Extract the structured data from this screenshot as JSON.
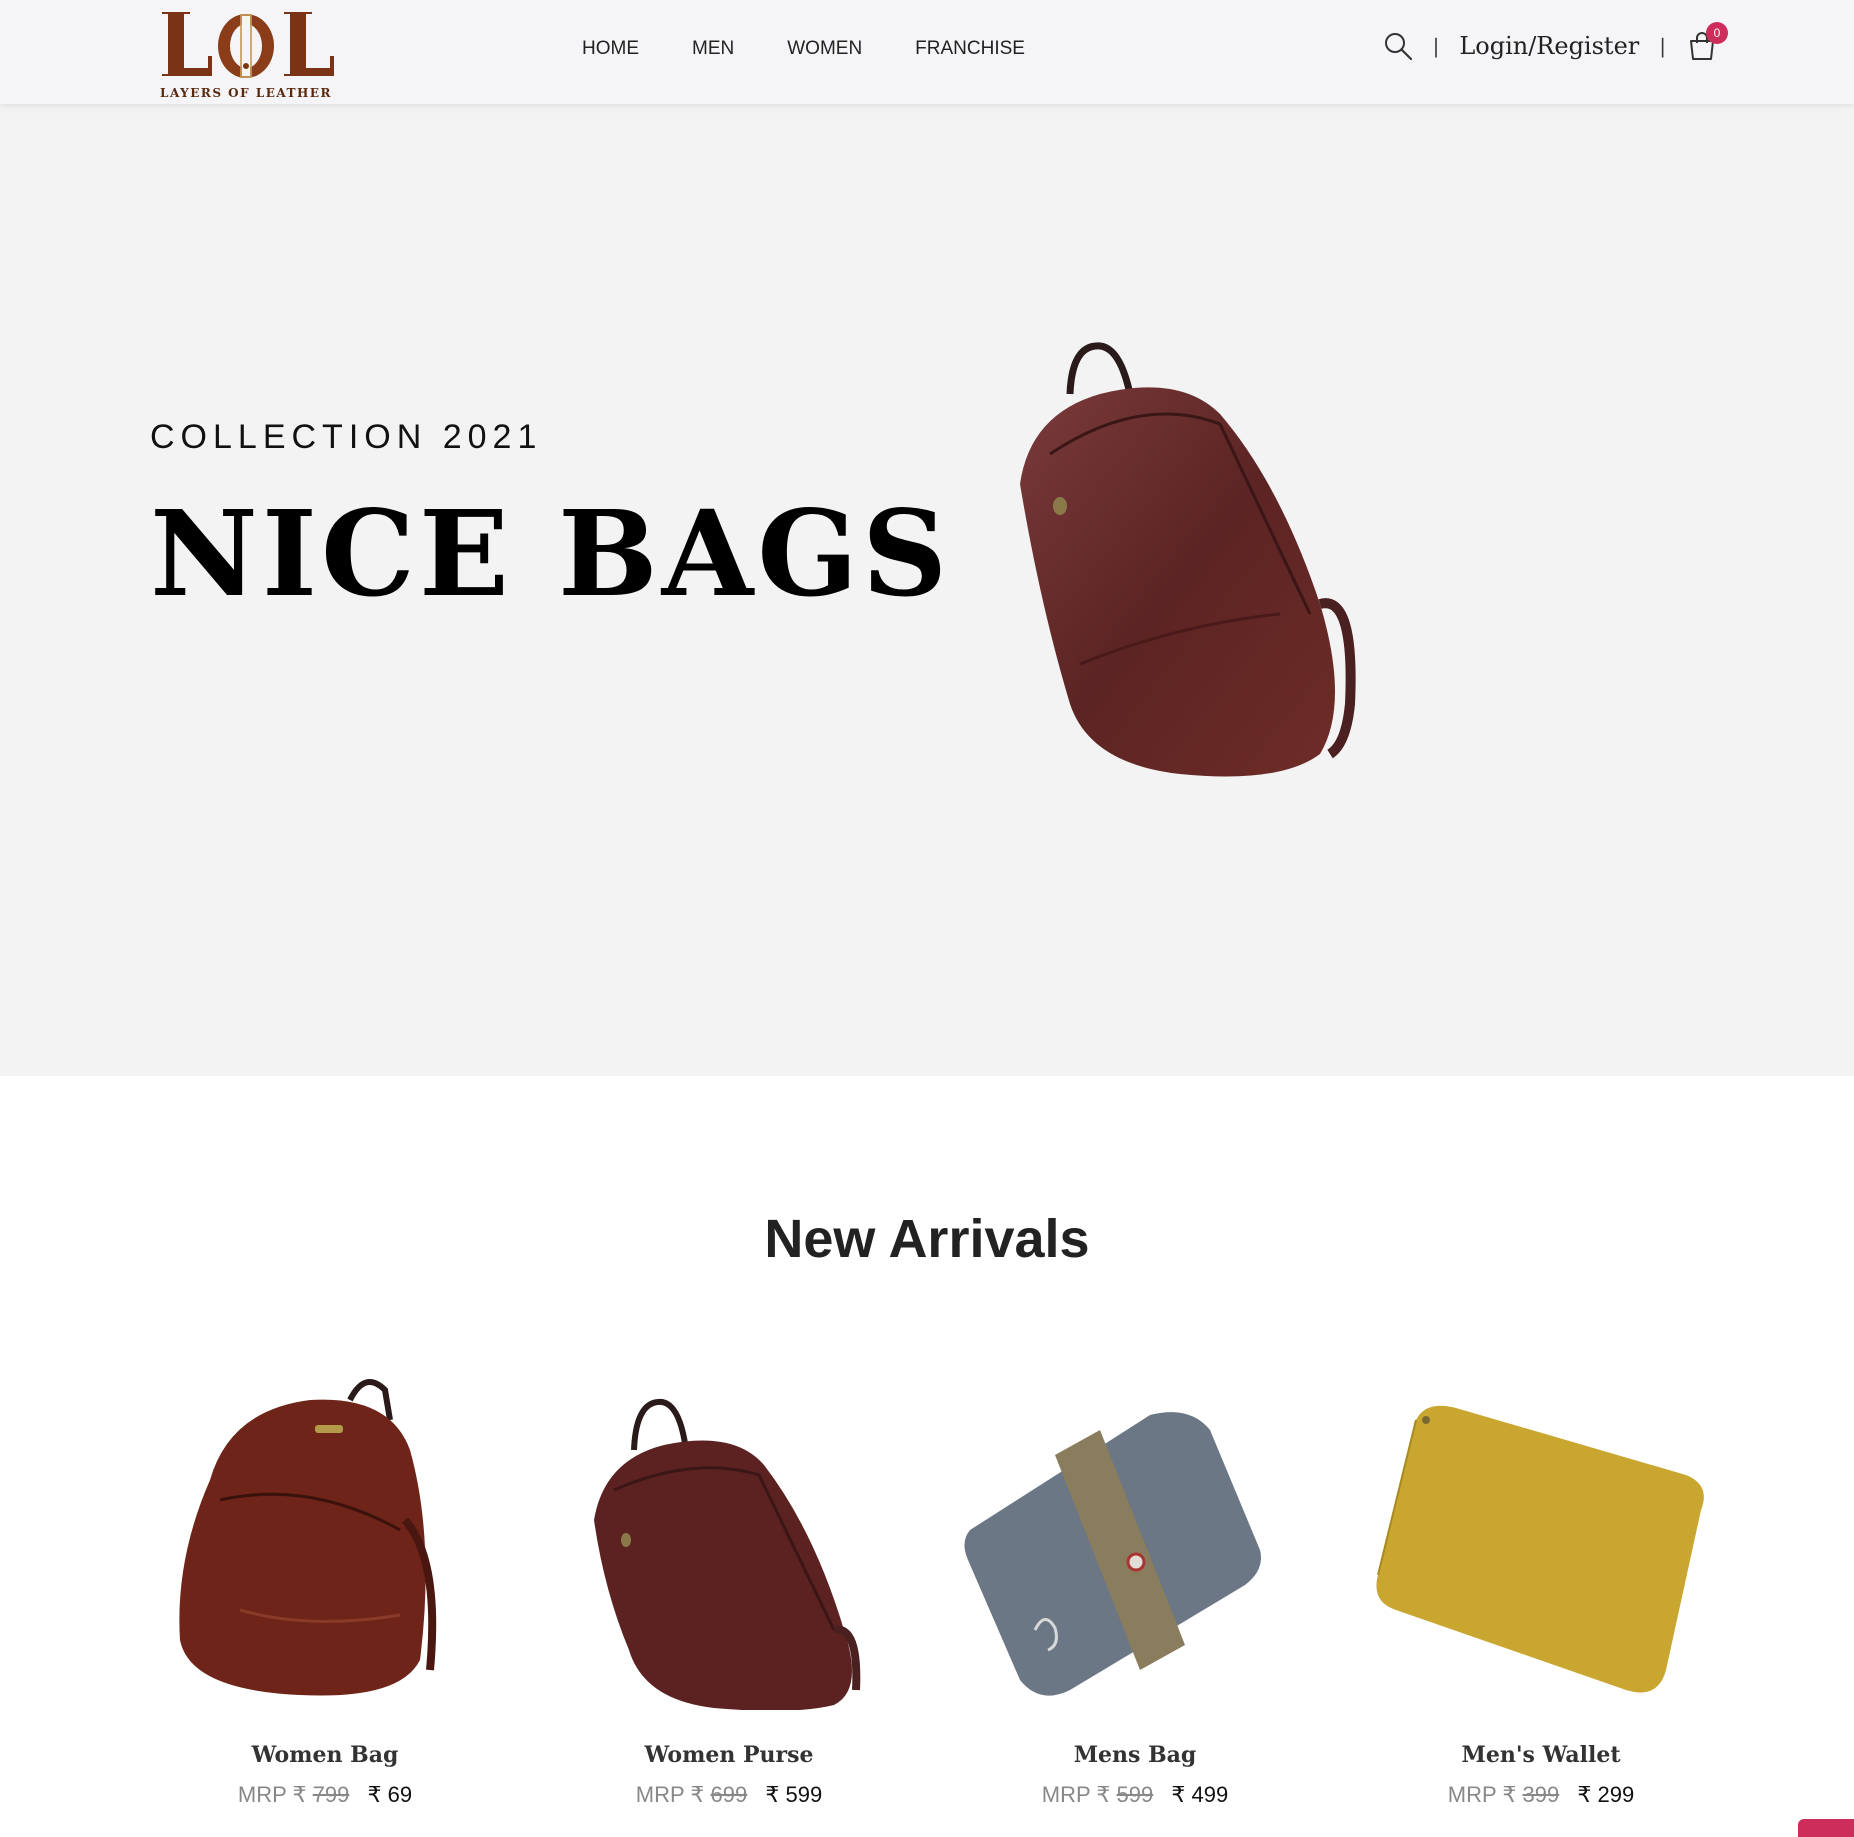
{
  "brand": {
    "logo_text": "LOL",
    "tagline": "LAYERS OF LEATHER",
    "colors": {
      "logo": "#7a3415",
      "accent": "#cc2d5a"
    }
  },
  "nav": {
    "items": [
      {
        "label": "HOME"
      },
      {
        "label": "MEN"
      },
      {
        "label": "WOMEN"
      },
      {
        "label": "FRANCHISE"
      }
    ]
  },
  "header": {
    "search_icon": "search-icon",
    "separator": "|",
    "login_label": "Login/Register",
    "cart_icon": "shopping-bag-icon",
    "cart_count": "0"
  },
  "hero": {
    "subtitle": "COLLECTION 2021",
    "title": "NICE BAGS",
    "background": "#f3f3f4"
  },
  "arrivals": {
    "title": "New Arrivals",
    "products": [
      {
        "name": "Women Bag",
        "mrp_label": "MRP ₹",
        "old_price": "799",
        "price": "₹ 69"
      },
      {
        "name": "Women Purse",
        "mrp_label": "MRP ₹",
        "old_price": "699",
        "price": "₹ 599"
      },
      {
        "name": "Mens Bag",
        "mrp_label": "MRP ₹",
        "old_price": "599",
        "price": "₹ 499"
      },
      {
        "name": "Men's Wallet",
        "mrp_label": "MRP ₹",
        "old_price": "399",
        "price": "₹ 299"
      }
    ]
  }
}
